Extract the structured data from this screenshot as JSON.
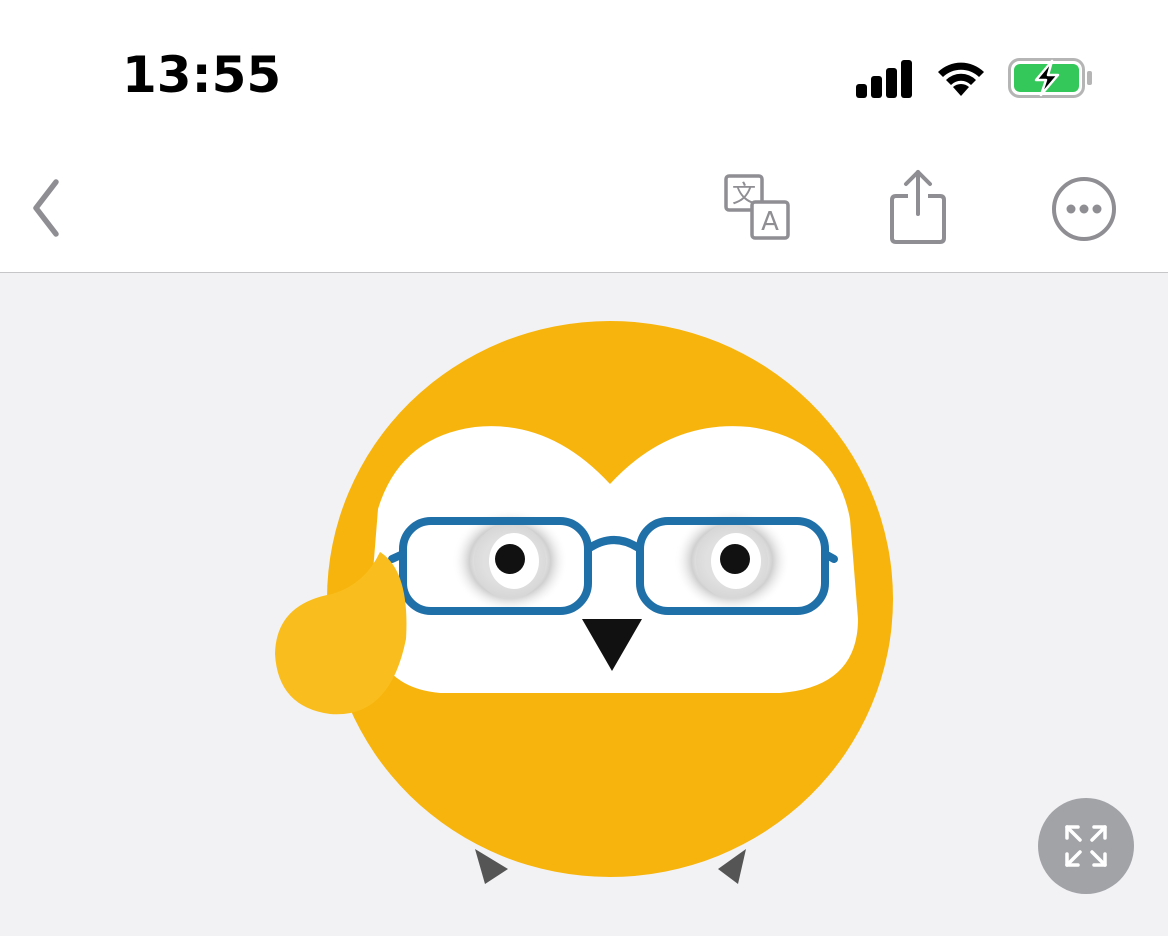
{
  "status_bar": {
    "time": "13:55",
    "signal_icon": "cellular-signal-icon",
    "wifi_icon": "wifi-icon",
    "battery_icon": "battery-charging-icon",
    "battery_color": "#34c759"
  },
  "nav_bar": {
    "back_icon": "chevron-left-icon",
    "translate_icon": "translate-icon",
    "share_icon": "share-icon",
    "more_icon": "more-ellipsis-icon",
    "icon_color": "#8e8e93"
  },
  "image_view": {
    "subject": "owl-avatar-image",
    "expand_icon": "expand-fullscreen-icon",
    "brand_color": "#f7b40c",
    "glasses_color": "#1f6fa8"
  }
}
